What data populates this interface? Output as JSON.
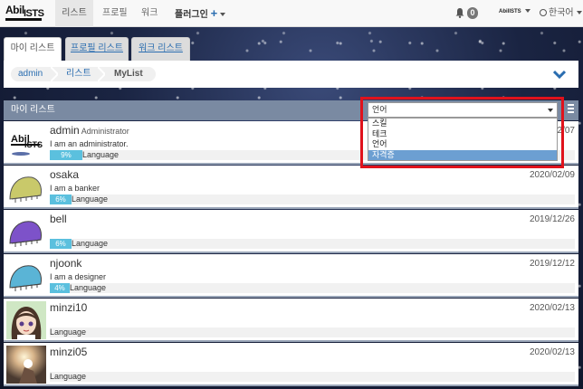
{
  "navbar": {
    "logo_top": "Abil",
    "logo_bottom": "ISTS",
    "items": [
      {
        "label": "리스트",
        "active": true
      },
      {
        "label": "프로필"
      },
      {
        "label": "워크"
      }
    ],
    "plugin_label": "플러그인",
    "notifications_count": "0",
    "mini_logo": "AbilISTS",
    "language_label": "한국어"
  },
  "tabs": [
    {
      "label": "마이 리스트"
    },
    {
      "label": "프로필 리스트"
    },
    {
      "label": "워크 리스트"
    }
  ],
  "breadcrumb": [
    "admin",
    "리스트",
    "MyList"
  ],
  "list": {
    "title": "마이 리스트",
    "filter": {
      "selected": "언어",
      "options": [
        "스킬",
        "테크",
        "언어",
        "자격증"
      ],
      "highlighted": "자격증"
    },
    "rows": [
      {
        "name": "admin",
        "role": "Administrator",
        "bio": "I am an administrator.",
        "percent_label": "9%",
        "progress": 0.09,
        "category": "Language",
        "date": "2020/02/07",
        "avatar": "abilists-logo"
      },
      {
        "name": "osaka",
        "role": "",
        "bio": "I am a banker",
        "percent_label": "6%",
        "progress": 0.06,
        "category": "Language",
        "date": "2020/02/09",
        "avatar": "yellow-bug"
      },
      {
        "name": "bell",
        "role": "",
        "bio": "",
        "percent_label": "6%",
        "progress": 0.06,
        "category": "Language",
        "date": "2019/12/26",
        "avatar": "purple-bug"
      },
      {
        "name": "njoonk",
        "role": "",
        "bio": "I am a designer",
        "percent_label": "4%",
        "progress": 0.04,
        "category": "Language",
        "date": "2019/12/12",
        "avatar": "blue-bug"
      },
      {
        "name": "minzi10",
        "role": "",
        "bio": "",
        "percent_label": "",
        "progress": 0,
        "category": "Language",
        "date": "2020/02/13",
        "avatar": "anime-girl"
      },
      {
        "name": "minzi05",
        "role": "",
        "bio": "",
        "percent_label": "",
        "progress": 0,
        "category": "Language",
        "date": "2020/02/13",
        "avatar": "photo-light"
      }
    ]
  }
}
